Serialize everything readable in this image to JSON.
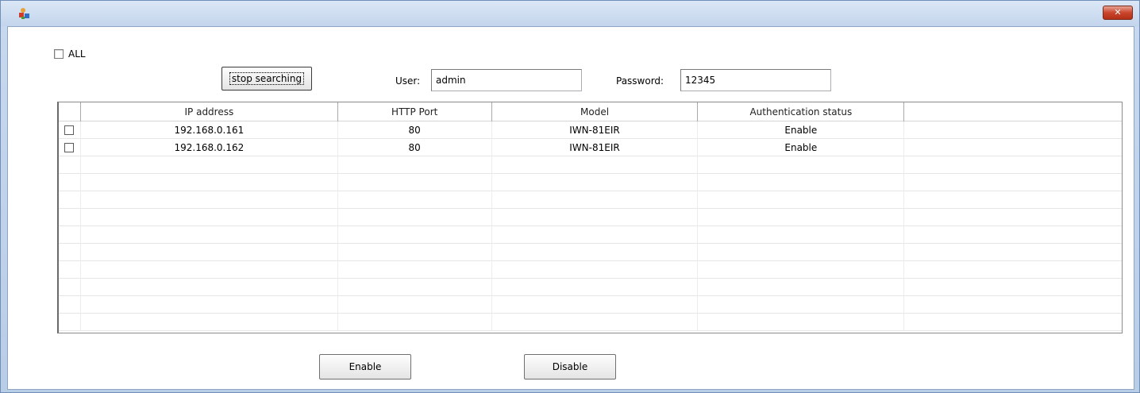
{
  "window": {
    "close_label": "✕"
  },
  "controls": {
    "all_label": "ALL",
    "stop_label": "stop searching",
    "user_label": "User:",
    "user_value": "admin",
    "password_label": "Password:",
    "password_value": "12345"
  },
  "table": {
    "columns": [
      "",
      "IP address",
      "HTTP Port",
      "Model",
      "Authentication status",
      ""
    ],
    "rows": [
      {
        "ip": "192.168.0.161",
        "port": "80",
        "model": "IWN-81EIR",
        "auth": "Enable"
      },
      {
        "ip": "192.168.0.162",
        "port": "80",
        "model": "IWN-81EIR",
        "auth": "Enable"
      }
    ],
    "empty_rows": 10
  },
  "actions": {
    "enable_label": "Enable",
    "disable_label": "Disable"
  }
}
